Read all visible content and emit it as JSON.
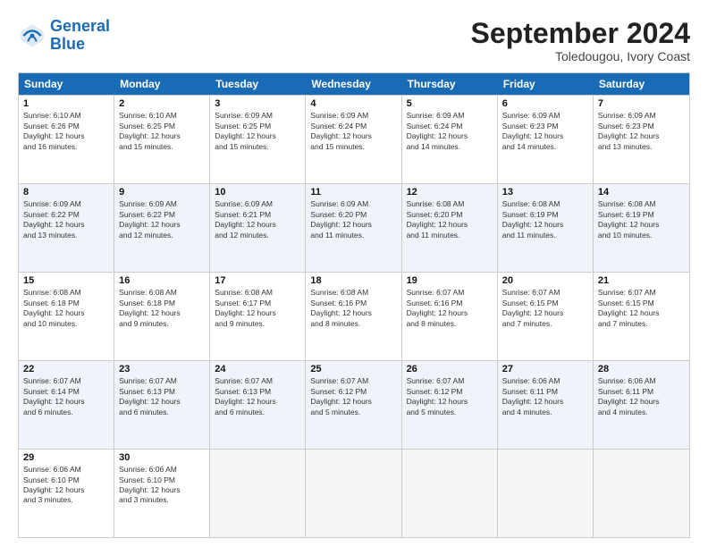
{
  "logo": {
    "line1": "General",
    "line2": "Blue"
  },
  "title": "September 2024",
  "location": "Toledougou, Ivory Coast",
  "days": [
    "Sunday",
    "Monday",
    "Tuesday",
    "Wednesday",
    "Thursday",
    "Friday",
    "Saturday"
  ],
  "rows": [
    [
      {
        "day": "1",
        "info": "Sunrise: 6:10 AM\nSunset: 6:26 PM\nDaylight: 12 hours\nand 16 minutes."
      },
      {
        "day": "2",
        "info": "Sunrise: 6:10 AM\nSunset: 6:25 PM\nDaylight: 12 hours\nand 15 minutes."
      },
      {
        "day": "3",
        "info": "Sunrise: 6:09 AM\nSunset: 6:25 PM\nDaylight: 12 hours\nand 15 minutes."
      },
      {
        "day": "4",
        "info": "Sunrise: 6:09 AM\nSunset: 6:24 PM\nDaylight: 12 hours\nand 15 minutes."
      },
      {
        "day": "5",
        "info": "Sunrise: 6:09 AM\nSunset: 6:24 PM\nDaylight: 12 hours\nand 14 minutes."
      },
      {
        "day": "6",
        "info": "Sunrise: 6:09 AM\nSunset: 6:23 PM\nDaylight: 12 hours\nand 14 minutes."
      },
      {
        "day": "7",
        "info": "Sunrise: 6:09 AM\nSunset: 6:23 PM\nDaylight: 12 hours\nand 13 minutes."
      }
    ],
    [
      {
        "day": "8",
        "info": "Sunrise: 6:09 AM\nSunset: 6:22 PM\nDaylight: 12 hours\nand 13 minutes."
      },
      {
        "day": "9",
        "info": "Sunrise: 6:09 AM\nSunset: 6:22 PM\nDaylight: 12 hours\nand 12 minutes."
      },
      {
        "day": "10",
        "info": "Sunrise: 6:09 AM\nSunset: 6:21 PM\nDaylight: 12 hours\nand 12 minutes."
      },
      {
        "day": "11",
        "info": "Sunrise: 6:09 AM\nSunset: 6:20 PM\nDaylight: 12 hours\nand 11 minutes."
      },
      {
        "day": "12",
        "info": "Sunrise: 6:08 AM\nSunset: 6:20 PM\nDaylight: 12 hours\nand 11 minutes."
      },
      {
        "day": "13",
        "info": "Sunrise: 6:08 AM\nSunset: 6:19 PM\nDaylight: 12 hours\nand 11 minutes."
      },
      {
        "day": "14",
        "info": "Sunrise: 6:08 AM\nSunset: 6:19 PM\nDaylight: 12 hours\nand 10 minutes."
      }
    ],
    [
      {
        "day": "15",
        "info": "Sunrise: 6:08 AM\nSunset: 6:18 PM\nDaylight: 12 hours\nand 10 minutes."
      },
      {
        "day": "16",
        "info": "Sunrise: 6:08 AM\nSunset: 6:18 PM\nDaylight: 12 hours\nand 9 minutes."
      },
      {
        "day": "17",
        "info": "Sunrise: 6:08 AM\nSunset: 6:17 PM\nDaylight: 12 hours\nand 9 minutes."
      },
      {
        "day": "18",
        "info": "Sunrise: 6:08 AM\nSunset: 6:16 PM\nDaylight: 12 hours\nand 8 minutes."
      },
      {
        "day": "19",
        "info": "Sunrise: 6:07 AM\nSunset: 6:16 PM\nDaylight: 12 hours\nand 8 minutes."
      },
      {
        "day": "20",
        "info": "Sunrise: 6:07 AM\nSunset: 6:15 PM\nDaylight: 12 hours\nand 7 minutes."
      },
      {
        "day": "21",
        "info": "Sunrise: 6:07 AM\nSunset: 6:15 PM\nDaylight: 12 hours\nand 7 minutes."
      }
    ],
    [
      {
        "day": "22",
        "info": "Sunrise: 6:07 AM\nSunset: 6:14 PM\nDaylight: 12 hours\nand 6 minutes."
      },
      {
        "day": "23",
        "info": "Sunrise: 6:07 AM\nSunset: 6:13 PM\nDaylight: 12 hours\nand 6 minutes."
      },
      {
        "day": "24",
        "info": "Sunrise: 6:07 AM\nSunset: 6:13 PM\nDaylight: 12 hours\nand 6 minutes."
      },
      {
        "day": "25",
        "info": "Sunrise: 6:07 AM\nSunset: 6:12 PM\nDaylight: 12 hours\nand 5 minutes."
      },
      {
        "day": "26",
        "info": "Sunrise: 6:07 AM\nSunset: 6:12 PM\nDaylight: 12 hours\nand 5 minutes."
      },
      {
        "day": "27",
        "info": "Sunrise: 6:06 AM\nSunset: 6:11 PM\nDaylight: 12 hours\nand 4 minutes."
      },
      {
        "day": "28",
        "info": "Sunrise: 6:06 AM\nSunset: 6:11 PM\nDaylight: 12 hours\nand 4 minutes."
      }
    ],
    [
      {
        "day": "29",
        "info": "Sunrise: 6:06 AM\nSunset: 6:10 PM\nDaylight: 12 hours\nand 3 minutes."
      },
      {
        "day": "30",
        "info": "Sunrise: 6:06 AM\nSunset: 6:10 PM\nDaylight: 12 hours\nand 3 minutes."
      },
      {
        "day": "",
        "info": ""
      },
      {
        "day": "",
        "info": ""
      },
      {
        "day": "",
        "info": ""
      },
      {
        "day": "",
        "info": ""
      },
      {
        "day": "",
        "info": ""
      }
    ]
  ]
}
